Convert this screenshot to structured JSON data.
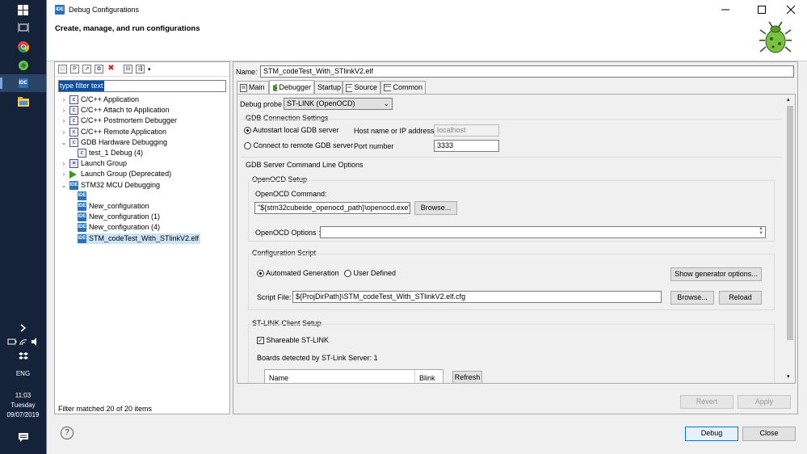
{
  "taskbar": {
    "language": "ENG",
    "time": "11:03",
    "day": "Tuesday",
    "date": "09/07/2019"
  },
  "window": {
    "title": "Debug Configurations",
    "banner": "Create, manage, and run configurations",
    "app_icon": "IDE"
  },
  "left": {
    "filter_placeholder": "type filter text",
    "status": "Filter matched 20 of 20 items",
    "tree": [
      {
        "label": "C/C++ Application",
        "indent": 0,
        "twisty": "›",
        "icon": "c"
      },
      {
        "label": "C/C++ Attach to Application",
        "indent": 0,
        "twisty": "›",
        "icon": "c"
      },
      {
        "label": "C/C++ Postmortem Debugger",
        "indent": 0,
        "twisty": "›",
        "icon": "c"
      },
      {
        "label": "C/C++ Remote Application",
        "indent": 0,
        "twisty": "›",
        "icon": "c"
      },
      {
        "label": "GDB Hardware Debugging",
        "indent": 0,
        "twisty": "⌄",
        "icon": "c"
      },
      {
        "label": "test_1 Debug (4)",
        "indent": 1,
        "twisty": "",
        "icon": "c"
      },
      {
        "label": "Launch Group",
        "indent": 0,
        "twisty": "›",
        "icon": "lg"
      },
      {
        "label": "Launch Group (Deprecated)",
        "indent": 0,
        "twisty": "›",
        "icon": "play"
      },
      {
        "label": "STM32 MCU Debugging",
        "indent": 0,
        "twisty": "⌄",
        "icon": "ide"
      },
      {
        "label": "",
        "indent": 1,
        "twisty": "",
        "icon": "ide"
      },
      {
        "label": "New_configuration",
        "indent": 1,
        "twisty": "",
        "icon": "ide"
      },
      {
        "label": "New_configuration (1)",
        "indent": 1,
        "twisty": "",
        "icon": "ide"
      },
      {
        "label": "New_configuration (4)",
        "indent": 1,
        "twisty": "",
        "icon": "ide"
      },
      {
        "label": "STM_codeTest_With_STlinkV2.elf",
        "indent": 1,
        "twisty": "",
        "icon": "ide",
        "selected": true
      }
    ]
  },
  "right": {
    "name_label": "Name:",
    "name_value": "STM_codeTest_With_STlinkV2.elf",
    "tabs": [
      "Main",
      "Debugger",
      "Startup",
      "Source",
      "Common"
    ],
    "debug_probe_label": "Debug probe",
    "debug_probe_value": "ST-LINK (OpenOCD)",
    "gdb_connection_title": "GDB Connection Settings",
    "autostart_label": "Autostart local GDB server",
    "connect_remote_label": "Connect to remote GDB server",
    "host_label": "Host name or IP address",
    "host_value": "localhost",
    "port_label": "Port number",
    "port_value": "3333",
    "cmdline_title": "GDB Server Command Line Options",
    "openocd_setup_title": "OpenOCD Setup",
    "openocd_command_label": "OpenOCD Command:",
    "openocd_command_value": "\"${stm32cubeide_openocd_path}\\openocd.exe\"",
    "browse_label": "Browse...",
    "openocd_options_label": "OpenOCD Options :",
    "config_script_title": "Configuration Script",
    "automated_label": "Automated Generation",
    "user_defined_label": "User Defined",
    "show_generator_label": "Show generator options...",
    "script_file_label": "Script File:",
    "script_file_value": "${ProjDirPath}\\STM_codeTest_With_STlinkV2.elf.cfg",
    "browse2_label": "Browse...",
    "reload_label": "Reload",
    "stlink_client_title": "ST-LINK Client Setup",
    "shareable_label": "Shareable ST-LINK",
    "boards_label": "Boards detected by ST-Link Server: 1",
    "col_name": "Name",
    "col_blink": "Blink",
    "refresh_label": "Refresh",
    "revert_label": "Revert",
    "apply_label": "Apply"
  },
  "footer": {
    "help": "?",
    "debug_label": "Debug",
    "close_label": "Close"
  }
}
